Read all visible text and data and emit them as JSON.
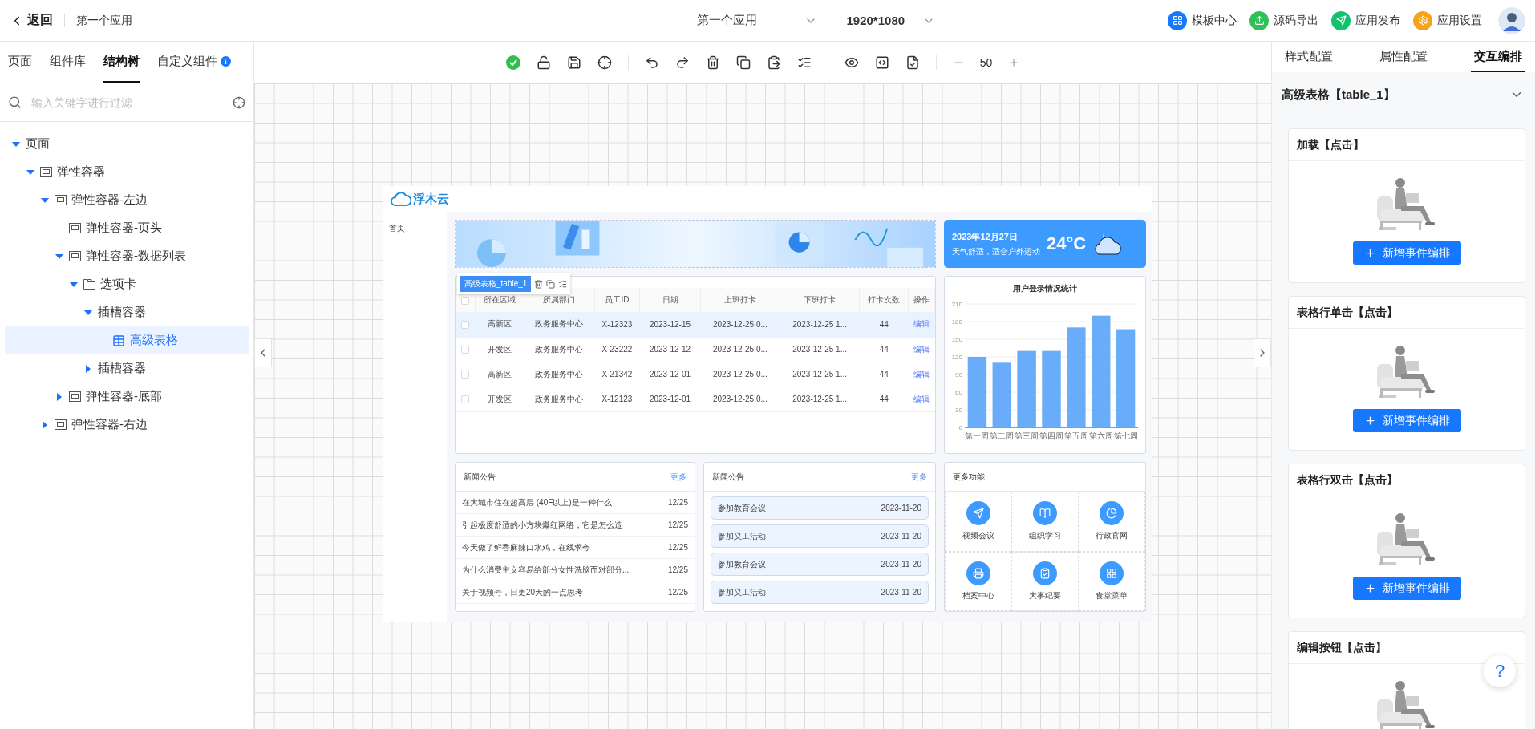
{
  "top_bar": {
    "back": "返回",
    "app_name": "第一个应用",
    "app_select": "第一个应用",
    "resolution": "1920*1080",
    "actions": [
      {
        "label": "模板中心",
        "color": "#1677ff"
      },
      {
        "label": "源码导出",
        "color": "#2fc05a"
      },
      {
        "label": "应用发布",
        "color": "#12c26d"
      },
      {
        "label": "应用设置",
        "color": "#f6a21b"
      }
    ]
  },
  "left_panel": {
    "tabs": [
      {
        "label": "页面",
        "selected": false
      },
      {
        "label": "组件库",
        "selected": false
      },
      {
        "label": "结构树",
        "selected": true
      },
      {
        "label": "自定义组件",
        "selected": false
      }
    ],
    "search": {
      "placeholder": "输入关键字进行过滤"
    },
    "tree": [
      {
        "label": "页面",
        "expanded": true,
        "selected": false,
        "children": [
          {
            "label": "弹性容器",
            "kind": "container",
            "expanded": true,
            "selected": false,
            "children": [
              {
                "label": "弹性容器-左边",
                "kind": "container",
                "expanded": true,
                "selected": false,
                "children": [
                  {
                    "label": "弹性容器-页头",
                    "kind": "container",
                    "selected": false
                  },
                  {
                    "label": "弹性容器-数据列表",
                    "kind": "container",
                    "expanded": true,
                    "selected": false,
                    "children": [
                      {
                        "label": "选项卡",
                        "kind": "tabs",
                        "expanded": true,
                        "selected": false,
                        "children": [
                          {
                            "label": "插槽容器",
                            "expanded": true,
                            "selected": false,
                            "children": [
                              {
                                "label": "高级表格",
                                "kind": "table",
                                "selected": true
                              }
                            ]
                          },
                          {
                            "label": "插槽容器",
                            "expanded": false,
                            "selected": false
                          }
                        ]
                      }
                    ]
                  },
                  {
                    "label": "弹性容器-底部",
                    "kind": "container",
                    "expanded": false,
                    "selected": false
                  }
                ]
              },
              {
                "label": "弹性容器-右边",
                "kind": "container",
                "expanded": false,
                "selected": false
              }
            ]
          }
        ]
      }
    ]
  },
  "toolbar": {
    "zoom": "50"
  },
  "preview": {
    "logo": "浮木云",
    "nav": [
      "首页"
    ],
    "table": {
      "badge": "高级表格_table_1",
      "all_checked": false,
      "columns": [
        "所在区域",
        "所属部门",
        "员工ID",
        "日期",
        "上班打卡",
        "下班打卡",
        "打卡次数",
        "操作"
      ],
      "rows": [
        {
          "cells": [
            "高新区",
            "政务服务中心",
            "X-12323",
            "2023-12-15",
            "2023-12-25 0...",
            "2023-12-25 1...",
            "44"
          ],
          "action": "编辑",
          "checked": false,
          "selected": true
        },
        {
          "cells": [
            "开发区",
            "政务服务中心",
            "X-23222",
            "2023-12-12",
            "2023-12-25 0...",
            "2023-12-25 1...",
            "44"
          ],
          "action": "编辑",
          "checked": false,
          "selected": false
        },
        {
          "cells": [
            "高新区",
            "政务服务中心",
            "X-21342",
            "2023-12-01",
            "2023-12-25 0...",
            "2023-12-25 1...",
            "44"
          ],
          "action": "编辑",
          "checked": false,
          "selected": false
        },
        {
          "cells": [
            "开发区",
            "政务服务中心",
            "X-12123",
            "2023-12-01",
            "2023-12-25 0...",
            "2023-12-25 1...",
            "44"
          ],
          "action": "编辑",
          "checked": false,
          "selected": false
        }
      ]
    },
    "weather": {
      "date": "2023年12月27日",
      "note": "天气舒适，适合户外运动",
      "temperature": "24°C"
    },
    "chart_card": {
      "chart_data": {
        "type": "bar",
        "title": "用户登录情况统计",
        "categories": [
          "第一周",
          "第二周",
          "第三周",
          "第四周",
          "第五周",
          "第六周",
          "第七周"
        ],
        "grid": true,
        "series": [
          {
            "color": "#69acf9",
            "values": [
              120,
              110,
              130,
              130,
              170,
              190,
              167
            ]
          }
        ],
        "ylim": [
          0,
          210
        ],
        "yticks": [
          0,
          30,
          60,
          90,
          120,
          150,
          180,
          210
        ]
      }
    },
    "news": {
      "title": "新闻公告",
      "more": "更多",
      "items": [
        {
          "text": "在大城市住在超高层 (40F以上)是一种什么",
          "date": "12/25"
        },
        {
          "text": "引起极度舒适的小方块爆红网络，它是怎么造",
          "date": "12/25"
        },
        {
          "text": "今天做了鲜香麻辣口水鸡，在线求夸",
          "date": "12/25"
        },
        {
          "text": "为什么消费主义容易给部分女性洗脑而对部分...",
          "date": "12/25"
        },
        {
          "text": "关于视频号，日更20天的一点思考",
          "date": "12/25"
        }
      ]
    },
    "events": {
      "title": "新闻公告",
      "more": "更多",
      "items": [
        {
          "text": "参加教育会议",
          "date": "2023-11-20"
        },
        {
          "text": "参加义工活动",
          "date": "2023-11-20"
        },
        {
          "text": "参加教育会议",
          "date": "2023-11-20"
        },
        {
          "text": "参加义工活动",
          "date": "2023-11-20"
        }
      ]
    },
    "functions": {
      "title": "更多功能",
      "items": [
        "视频会议",
        "组织学习",
        "行政官网",
        "档案中心",
        "大事纪要",
        "食堂菜单"
      ]
    }
  },
  "right_panel": {
    "tabs": [
      {
        "label": "样式配置",
        "selected": false
      },
      {
        "label": "属性配置",
        "selected": false
      },
      {
        "label": "交互编排",
        "selected": true
      }
    ],
    "component": "高级表格【table_1】",
    "events": [
      {
        "title": "加载【点击】",
        "button": "新增事件编排"
      },
      {
        "title": "表格行单击【点击】",
        "button": "新增事件编排"
      },
      {
        "title": "表格行双击【点击】",
        "button": "新增事件编排"
      },
      {
        "title": "编辑按钮【点击】"
      }
    ]
  },
  "help": "?"
}
